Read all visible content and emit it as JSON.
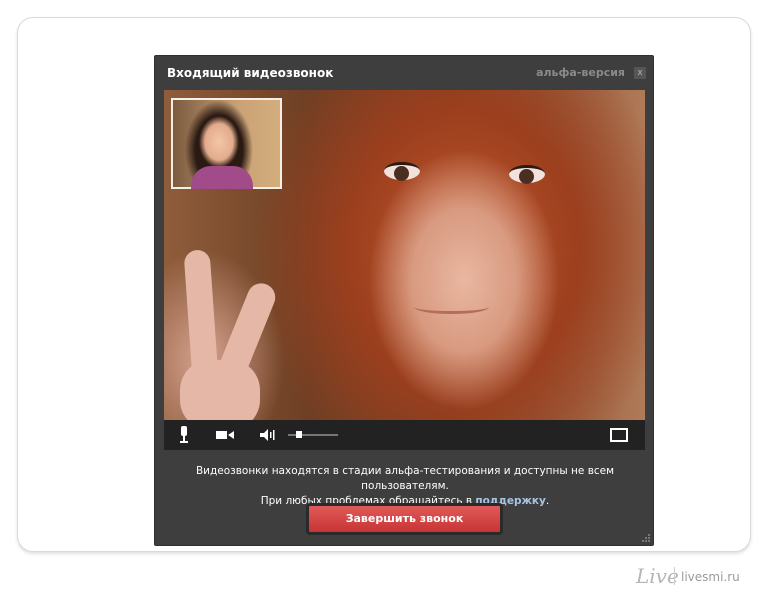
{
  "dialog": {
    "title": "Входящий видеозвонок",
    "alpha_label": "альфа-версия",
    "close_glyph": "x"
  },
  "controls": {
    "mic_icon": "microphone-icon",
    "camera_icon": "video-camera-icon",
    "volume_icon": "speaker-icon",
    "volume_level": 0.15,
    "fullscreen_icon": "fullscreen-icon"
  },
  "notice": {
    "line1": "Видеозвонки находятся в стадии альфа-тестирования и доступны не всем пользователям.",
    "line2_prefix": "При любых проблемах обращайтесь в",
    "support_link": "поддержку",
    "line2_suffix": "."
  },
  "end_call_button": "Завершить звонок",
  "watermark": {
    "logo": "Live",
    "site": "livesmi.ru"
  },
  "colors": {
    "dialog_bg": "#3e3e3e",
    "button_red": "#c83434",
    "link": "#a7c4e2"
  }
}
